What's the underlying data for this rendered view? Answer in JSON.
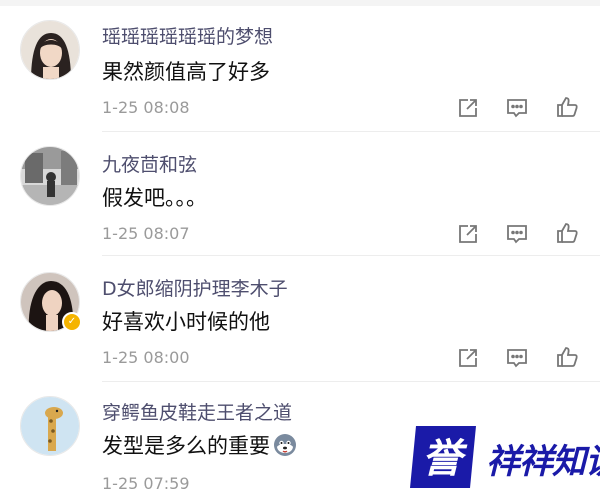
{
  "comments": [
    {
      "username": "瑶瑶瑶瑶瑶瑶的梦想",
      "text": "果然颜值高了好多",
      "time": "1-25 08:08",
      "avatar": "woman-long-hair-avatar",
      "verified": false
    },
    {
      "username": "九夜茴和弦",
      "text": "假发吧。。。",
      "time": "1-25 08:07",
      "avatar": "street-scene-avatar",
      "verified": false
    },
    {
      "username": "D女郎缩阴护理李木子",
      "text": "好喜欢小时候的他",
      "time": "1-25 08:00",
      "avatar": "woman-dark-hair-avatar",
      "verified": true
    },
    {
      "username": "穿鳄鱼皮鞋走王者之道",
      "text": "发型是多么的重要",
      "time": "1-25 07:59",
      "avatar": "giraffe-avatar",
      "verified": false,
      "emoji": "husky-emoji"
    }
  ],
  "actions": [
    "share-icon",
    "comment-icon",
    "like-icon"
  ],
  "watermark": {
    "badge_text": "誉",
    "text": "祥祥知识",
    "colors": {
      "badge": "#1a1aa8",
      "text": "#1a1aa8"
    }
  }
}
